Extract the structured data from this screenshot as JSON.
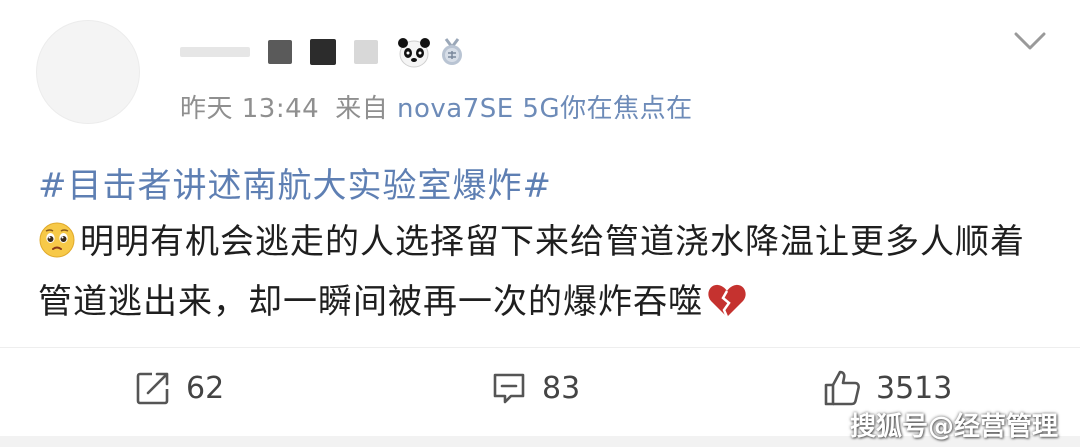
{
  "post": {
    "meta": {
      "time": "昨天 13:44",
      "source_prefix": "来自",
      "source": "nova7SE 5G你在焦点在"
    },
    "topic": "#目击者讲述南航大实验室爆炸#",
    "content": "明明有机会逃走的人选择留下来给管道浇水降温让更多人顺着管道逃出来，却一瞬间被再一次的爆炸吞噬"
  },
  "actions": {
    "repost_count": "62",
    "comment_count": "83",
    "like_count": "3513"
  },
  "watermark": "搜狐号@经营管理",
  "icons": {
    "avatar": "avatar-placeholder",
    "panda": "panda-badge-icon",
    "medal": "medal-badge-icon",
    "more": "chevron-down-icon",
    "emoji": "pleading-face-emoji",
    "broken_heart": "broken-heart-emoji",
    "repost": "repost-icon",
    "comment": "comment-icon",
    "like": "thumbs-up-icon"
  },
  "colors": {
    "link": "#5e7fb3",
    "meta": "#8f8f8f",
    "text": "#1f1f1f"
  }
}
